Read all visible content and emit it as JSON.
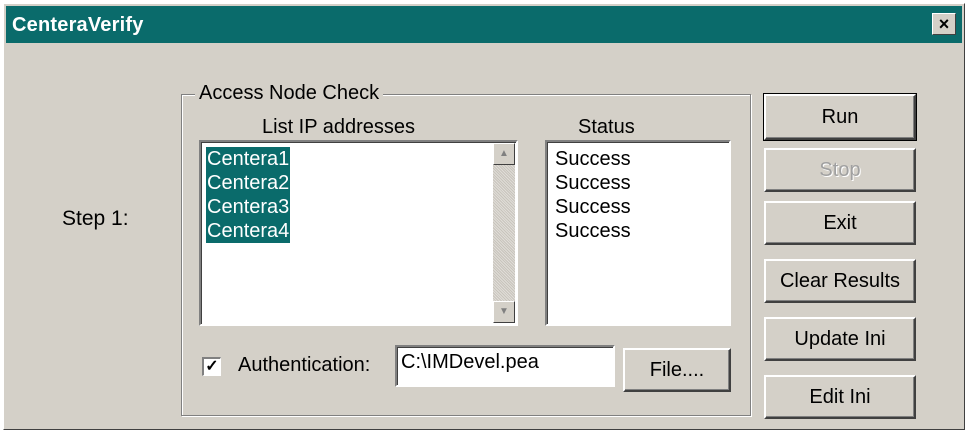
{
  "window": {
    "title": "CenteraVerify",
    "close_glyph": "×"
  },
  "step_label": "Step 1:",
  "group": {
    "title": "Access Node Check",
    "ip_header": "List IP addresses",
    "status_header": "Status",
    "ip_addresses": [
      "Centera1",
      "Centera2",
      "Centera3",
      "Centera4"
    ],
    "statuses": [
      "Success",
      "Success",
      "Success",
      "Success"
    ],
    "scroll_up_icon": "▲",
    "scroll_down_icon": "▼"
  },
  "auth": {
    "checked_glyph": "✓",
    "label": "Authentication:",
    "path_value": "C:\\IMDevel.pea",
    "file_button": "File...."
  },
  "buttons": {
    "run": "Run",
    "stop": "Stop",
    "exit": "Exit",
    "clear_results": "Clear Results",
    "update_ini": "Update Ini",
    "edit_ini": "Edit Ini"
  },
  "colors": {
    "title_bar": "#0a6b6b",
    "selection": "#0a6b6b",
    "face": "#d4d0c8"
  }
}
